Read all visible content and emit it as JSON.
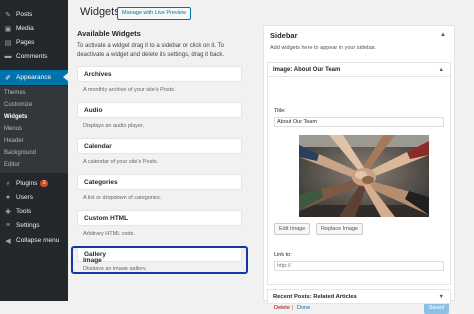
{
  "admin_menu": {
    "items": [
      {
        "label": "Posts",
        "icon": "pin-icon"
      },
      {
        "label": "Media",
        "icon": "media-icon"
      },
      {
        "label": "Pages",
        "icon": "pages-icon"
      },
      {
        "label": "Comments",
        "icon": "comment-icon"
      },
      {
        "label": "Appearance",
        "icon": "brush-icon"
      },
      {
        "label": "Plugins",
        "icon": "plug-icon",
        "badge": "2"
      },
      {
        "label": "Users",
        "icon": "user-icon"
      },
      {
        "label": "Tools",
        "icon": "wrench-icon"
      },
      {
        "label": "Settings",
        "icon": "sliders-icon"
      },
      {
        "label": "Collapse menu",
        "icon": "collapse-icon"
      }
    ],
    "submenu": [
      "Themes",
      "Customize",
      "Widgets",
      "Menus",
      "Header",
      "Background",
      "Editor"
    ]
  },
  "header": {
    "title": "Widgets",
    "live_preview_label": "Manage with Live Preview"
  },
  "available_widgets": {
    "heading": "Available Widgets",
    "description": "To activate a widget drag it to a sidebar or click on it. To deactivate a widget and delete its settings, drag it back.",
    "widgets": [
      {
        "title": "Archives",
        "description": "A monthly archive of your site's Posts."
      },
      {
        "title": "Audio",
        "description": "Displays an audio player."
      },
      {
        "title": "Calendar",
        "description": "A calendar of your site's Posts."
      },
      {
        "title": "Categories",
        "description": "A list or dropdown of categories."
      },
      {
        "title": "Custom HTML",
        "description": "Arbitrary HTML code."
      },
      {
        "title": "Gallery",
        "description": "Displays an image gallery."
      },
      {
        "title": "Image",
        "description": ""
      }
    ]
  },
  "sidebar": {
    "title": "Sidebar",
    "description": "Add widgets here to appear in your sidebar.",
    "image_widget": {
      "header": "Image: About Our Team",
      "title_label": "Title:",
      "title_value": "About Our Team",
      "edit_image_label": "Edit Image",
      "replace_image_label": "Replace Image",
      "link_label": "Link to:",
      "link_placeholder": "http://",
      "delete_label": "Delete",
      "separator": "|",
      "done_label": "Done",
      "saved_label": "Saved"
    },
    "recent_posts_widget": {
      "header": "Recent Posts: Related Articles"
    }
  },
  "colors": {
    "admin_bg": "#23282d",
    "submenu_bg": "#32373c",
    "accent": "#0073aa",
    "highlight_border": "#1436a8",
    "saved_button": "#8cc1e6",
    "delete_link": "#aa0000",
    "plugins_badge": "#d54e21"
  }
}
